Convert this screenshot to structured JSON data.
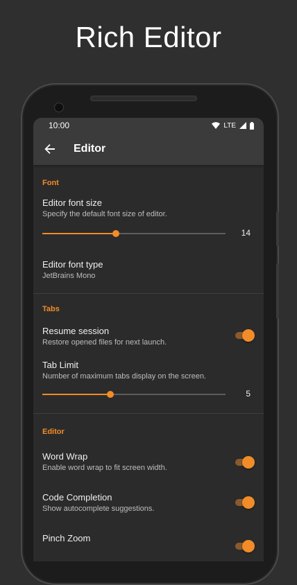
{
  "promo": {
    "title": "Rich Editor"
  },
  "status_bar": {
    "time": "10:00",
    "network": "LTE"
  },
  "toolbar": {
    "title": "Editor",
    "back_icon": "arrow-back-icon"
  },
  "sections": {
    "font": {
      "header": "Font",
      "font_size": {
        "title": "Editor font size",
        "summary": "Specify the default font size of editor.",
        "value": "14",
        "fraction": 0.4
      },
      "font_type": {
        "title": "Editor font type",
        "summary": "JetBrains Mono"
      }
    },
    "tabs": {
      "header": "Tabs",
      "resume_session": {
        "title": "Resume session",
        "summary": "Restore opened files for next launch.",
        "enabled": true
      },
      "tab_limit": {
        "title": "Tab Limit",
        "summary": "Number of maximum tabs display on the screen.",
        "value": "5",
        "fraction": 0.37
      }
    },
    "editor": {
      "header": "Editor",
      "word_wrap": {
        "title": "Word Wrap",
        "summary": "Enable word wrap to fit screen width.",
        "enabled": true
      },
      "code_completion": {
        "title": "Code Completion",
        "summary": "Show autocomplete suggestions.",
        "enabled": true
      },
      "pinch_zoom": {
        "title": "Pinch Zoom",
        "enabled": true
      }
    }
  },
  "colors": {
    "accent": "#f28c28",
    "background": "#2f2f2f",
    "toolbar": "#3b3b3b",
    "screen": "#2b2b2b"
  }
}
